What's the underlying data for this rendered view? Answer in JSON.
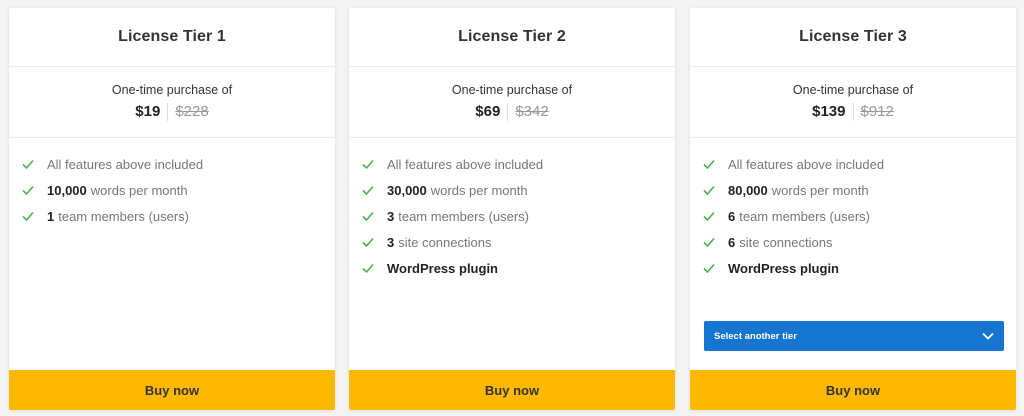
{
  "cards": [
    {
      "title": "License Tier 1",
      "purchase_label": "One-time purchase of",
      "price": "$19",
      "original_price": "$228",
      "features": [
        {
          "bold": "",
          "text": "All features above included"
        },
        {
          "bold": "10,000",
          "text": "words per month"
        },
        {
          "bold": "1",
          "text": "team members (users)"
        }
      ],
      "button_label": "Buy now"
    },
    {
      "title": "License Tier 2",
      "purchase_label": "One-time purchase of",
      "price": "$69",
      "original_price": "$342",
      "features": [
        {
          "bold": "",
          "text": "All features above included"
        },
        {
          "bold": "30,000",
          "text": "words per month"
        },
        {
          "bold": "3",
          "text": "team members (users)"
        },
        {
          "bold": "3",
          "text": "site connections"
        },
        {
          "bold": "WordPress plugin",
          "text": ""
        }
      ],
      "button_label": "Buy now"
    },
    {
      "title": "License Tier 3",
      "purchase_label": "One-time purchase of",
      "price": "$139",
      "original_price": "$912",
      "features": [
        {
          "bold": "",
          "text": "All features above included"
        },
        {
          "bold": "80,000",
          "text": "words per month"
        },
        {
          "bold": "6",
          "text": "team members (users)"
        },
        {
          "bold": "6",
          "text": "site connections"
        },
        {
          "bold": "WordPress plugin",
          "text": ""
        }
      ],
      "tier_select": {
        "label": "Select another tier",
        "icon": "chevron-down-icon"
      },
      "button_label": "Buy now"
    }
  ],
  "icons": {
    "feature": "check-icon"
  },
  "colors": {
    "check": "#4caf50",
    "buy_button": "#ffb800",
    "tier_select": "#1675d1",
    "background": "#f4f4f4"
  }
}
